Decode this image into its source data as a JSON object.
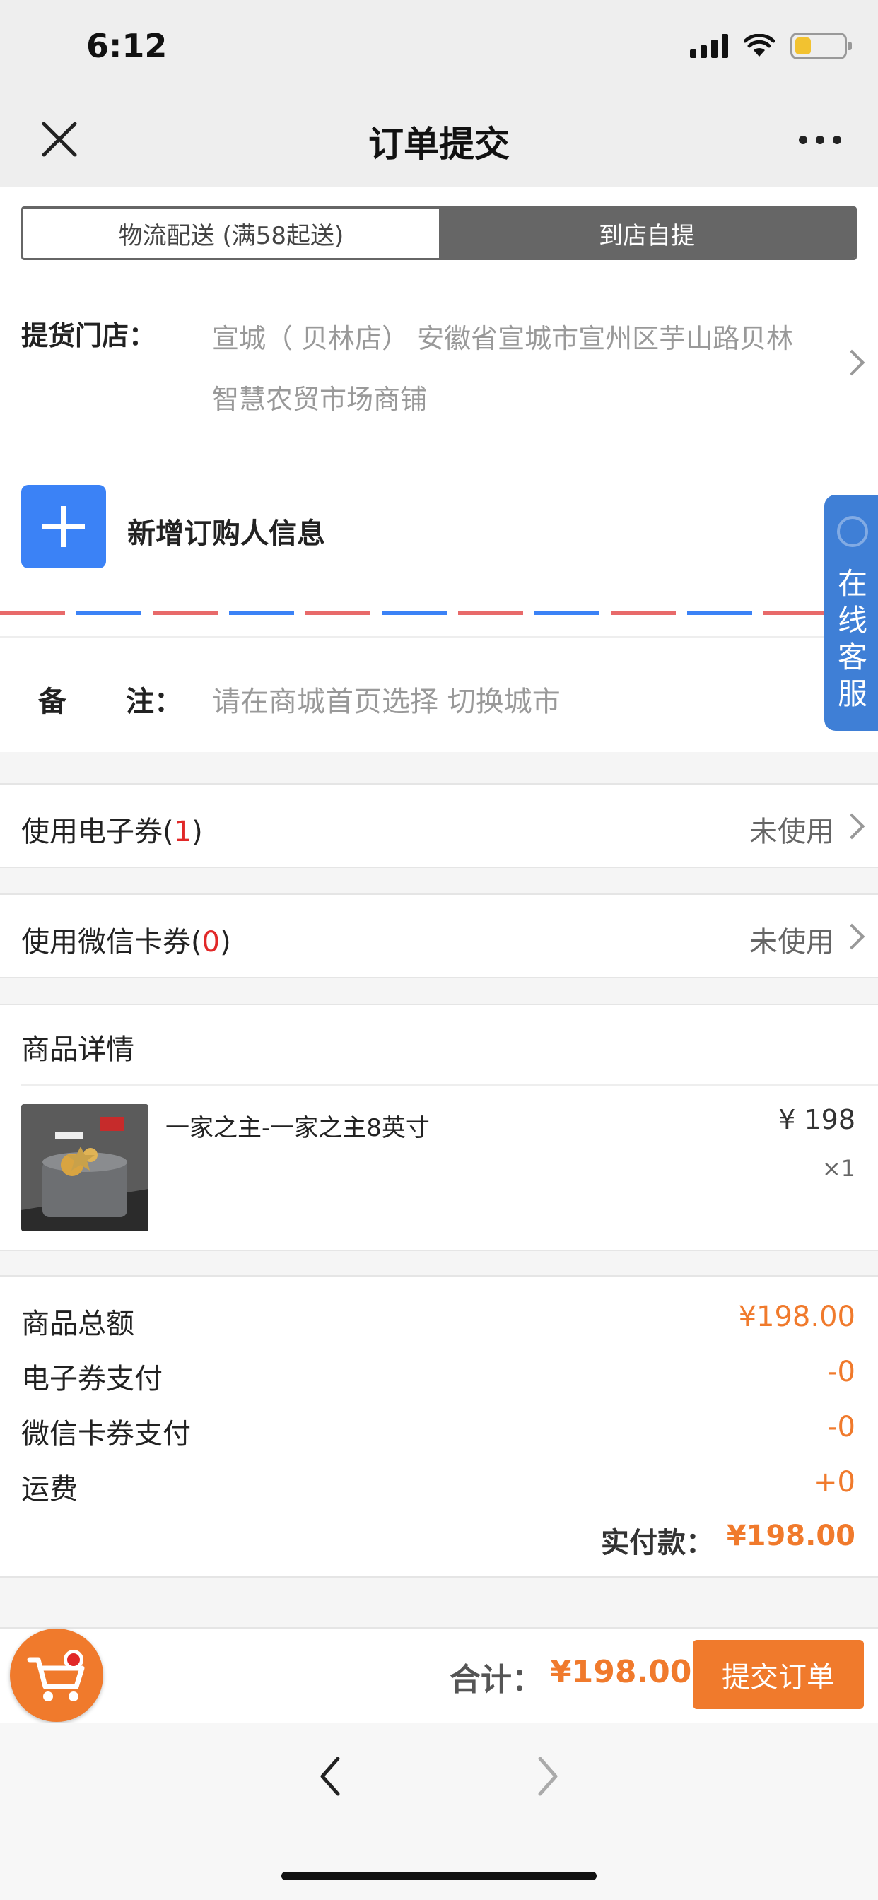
{
  "status_bar": {
    "time": "6:12"
  },
  "nav": {
    "title": "订单提交"
  },
  "delivery_tabs": [
    {
      "label": "物流配送 (满58起送)",
      "active": false
    },
    {
      "label": "到店自提",
      "active": true
    }
  ],
  "store": {
    "label": "提货门店：",
    "line1": "宣城（ 贝林店） 安徽省宣城市宣州区芋山路贝林",
    "line2": "智慧农贸市场商铺"
  },
  "buyer": {
    "add_label": "新增订购人信息"
  },
  "remark": {
    "label_char1": "备",
    "label_char2": "注：",
    "placeholder": "请在商城首页选择 切换城市"
  },
  "online_service": {
    "label": "在线客服"
  },
  "coupons": {
    "ecoupon": {
      "label": "使用电子券",
      "count": "1",
      "status": "未使用"
    },
    "wechat": {
      "label": "使用微信卡券",
      "count": "0",
      "status": "未使用"
    }
  },
  "product_section": {
    "title": "商品详情",
    "items": [
      {
        "name": "一家之主-一家之主8英寸",
        "price": "¥ 198",
        "qty": "×1"
      }
    ]
  },
  "summary": {
    "rows": [
      {
        "label": "商品总额",
        "value": "¥198.00"
      },
      {
        "label": "电子券支付",
        "value": "-0"
      },
      {
        "label": "微信卡券支付",
        "value": "-0"
      },
      {
        "label": "运费",
        "value": "+0"
      }
    ],
    "paid_label": "实付款：",
    "paid_value": "¥198.00"
  },
  "bottom": {
    "total_label": "合计：",
    "total_value": "¥198.00",
    "submit_label": "提交订单"
  },
  "colors": {
    "accent": "#f07a2c",
    "blue": "#3b82f6",
    "red": "#e12828"
  }
}
